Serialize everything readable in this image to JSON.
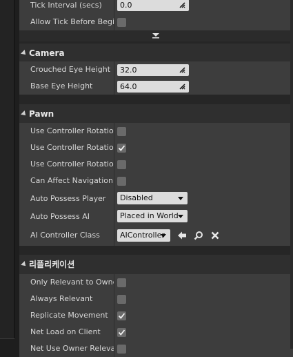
{
  "sections": {
    "tick": {
      "rows": [
        {
          "label": "Tick Interval (secs)",
          "value": "0.0"
        },
        {
          "label": "Allow Tick Before Begin",
          "checked": false
        }
      ]
    },
    "camera": {
      "title": "Camera",
      "rows": [
        {
          "label": "Crouched Eye Height",
          "value": "32.0"
        },
        {
          "label": "Base Eye Height",
          "value": "64.0"
        }
      ]
    },
    "pawn": {
      "title": "Pawn",
      "rows": [
        {
          "label": "Use Controller Rotation Pitch",
          "checked": false
        },
        {
          "label": "Use Controller Rotation Yaw",
          "checked": true
        },
        {
          "label": "Use Controller Rotation Roll",
          "checked": false
        },
        {
          "label": "Can Affect Navigation Generation",
          "checked": false
        },
        {
          "label": "Auto Possess Player",
          "value": "Disabled"
        },
        {
          "label": "Auto Possess AI",
          "value": "Placed in World"
        },
        {
          "label": "AI Controller Class",
          "value": "AIController"
        }
      ]
    },
    "replication": {
      "title": "리플리케이션",
      "rows": [
        {
          "label": "Only Relevant to Owner",
          "checked": false
        },
        {
          "label": "Always Relevant",
          "checked": false
        },
        {
          "label": "Replicate Movement",
          "checked": true
        },
        {
          "label": "Net Load on Client",
          "checked": true
        },
        {
          "label": "Net Use Owner Relevancy",
          "checked": false
        }
      ]
    }
  },
  "icons": {
    "expander": "chevron-down-icon",
    "use_selected": "arrow-left-icon",
    "browse": "magnifier-icon",
    "clear": "x-icon"
  }
}
